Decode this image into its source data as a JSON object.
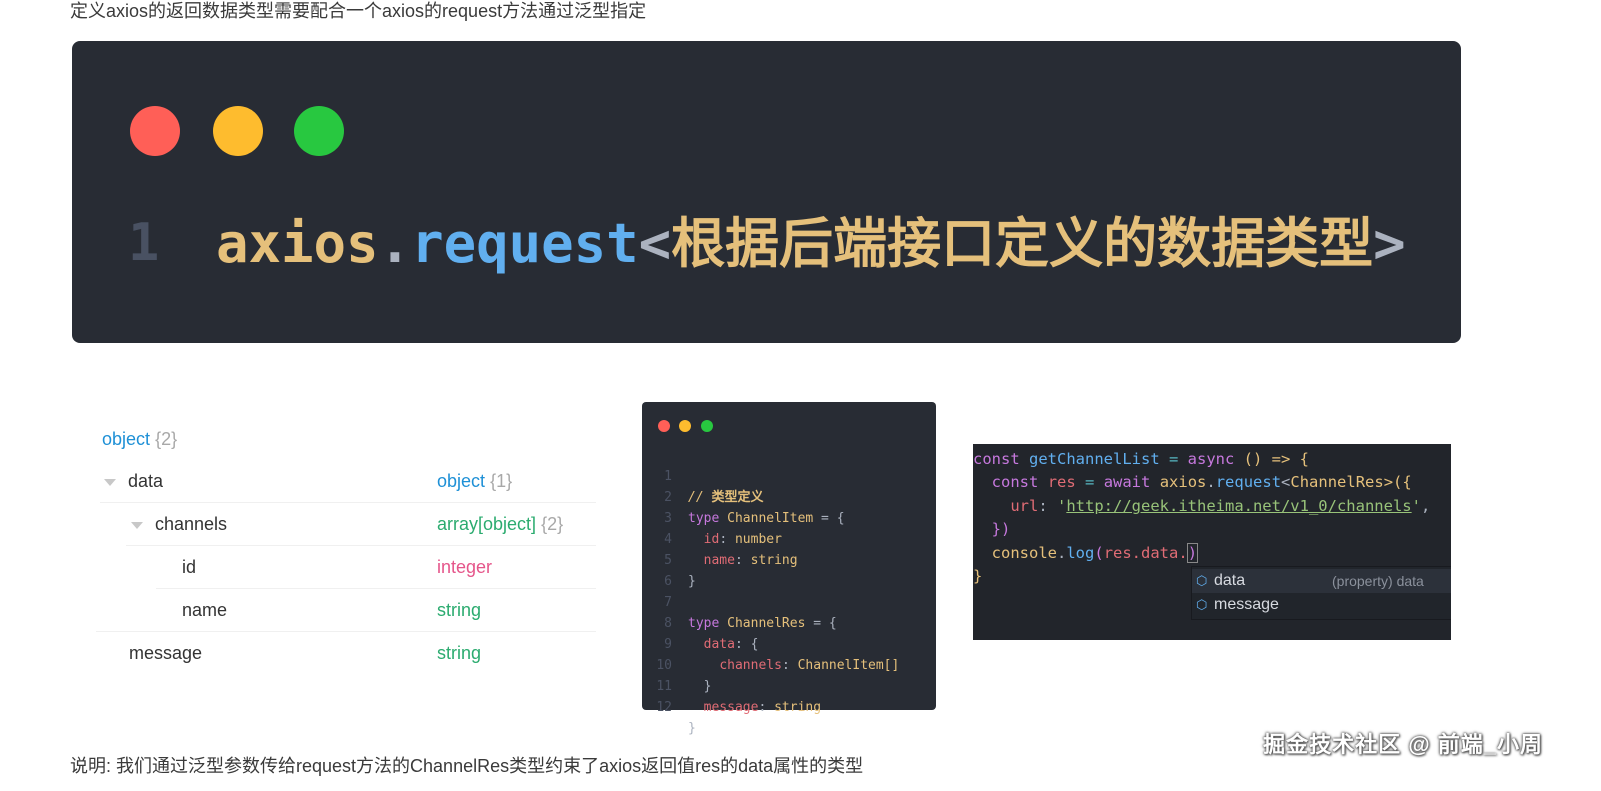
{
  "intro_text": "定义axios的返回数据类型需要配合一个axios的request方法通过泛型指定",
  "banner": {
    "line_number": "1",
    "obj": "axios",
    "dot": ".",
    "method": "request",
    "lt": "<",
    "type_text": "根据后端接口定义的数据类型",
    "gt": ">"
  },
  "schema": {
    "root": {
      "type": "object",
      "count": "{2}"
    },
    "rows": [
      {
        "name": "data",
        "type": "object",
        "count": "{1}"
      },
      {
        "name": "channels",
        "type": "array[object]",
        "count": "{2}"
      },
      {
        "name": "id",
        "type": "integer",
        "count": ""
      },
      {
        "name": "name",
        "type": "string",
        "count": ""
      },
      {
        "name": "message",
        "type": "string",
        "count": ""
      }
    ]
  },
  "code_card": {
    "line_numbers": [
      "1",
      "2",
      "3",
      "4",
      "5",
      "6",
      "7",
      "8",
      "9",
      "10",
      "11",
      "12"
    ],
    "comment_prefix": "// ",
    "comment_text": "类型定义",
    "kw_type": "type",
    "channel_item": "ChannelItem",
    "channel_res": "ChannelRes",
    "eq_brace": " = {",
    "prop_id": "id",
    "prop_name": "name",
    "prop_data": "data",
    "prop_channels": "channels",
    "prop_message": "message",
    "type_number": "number",
    "type_string": "string",
    "channel_item_array": "ChannelItem[]",
    "close_brace": "}"
  },
  "vscode": {
    "line1": {
      "kw": "const",
      "fn": "getChannelList",
      "eq": " = ",
      "async": "async",
      "rest": " () => {"
    },
    "line2": {
      "kw": "const",
      "var": "res",
      "eq": " = ",
      "await": "await",
      "obj": "axios",
      "method": "request",
      "type": "ChannelRes",
      "rest": ">({"
    },
    "line3": {
      "key": "url",
      "url": "http://geek.itheima.net/v1_0/channels"
    },
    "line4": "})",
    "line5": {
      "obj": "console",
      "method": "log",
      "arg": "res.data."
    },
    "line6": "}",
    "suggestions": [
      {
        "label": "data",
        "detail": "(property) data",
        "icon": "property-icon"
      },
      {
        "label": "message",
        "detail": "",
        "icon": "property-icon"
      }
    ]
  },
  "outro_text": "说明: 我们通过泛型参数传给request方法的ChannelRes类型约束了axios返回值res的data属性的类型",
  "watermark": "掘金技术社区 @ 前端_小周"
}
